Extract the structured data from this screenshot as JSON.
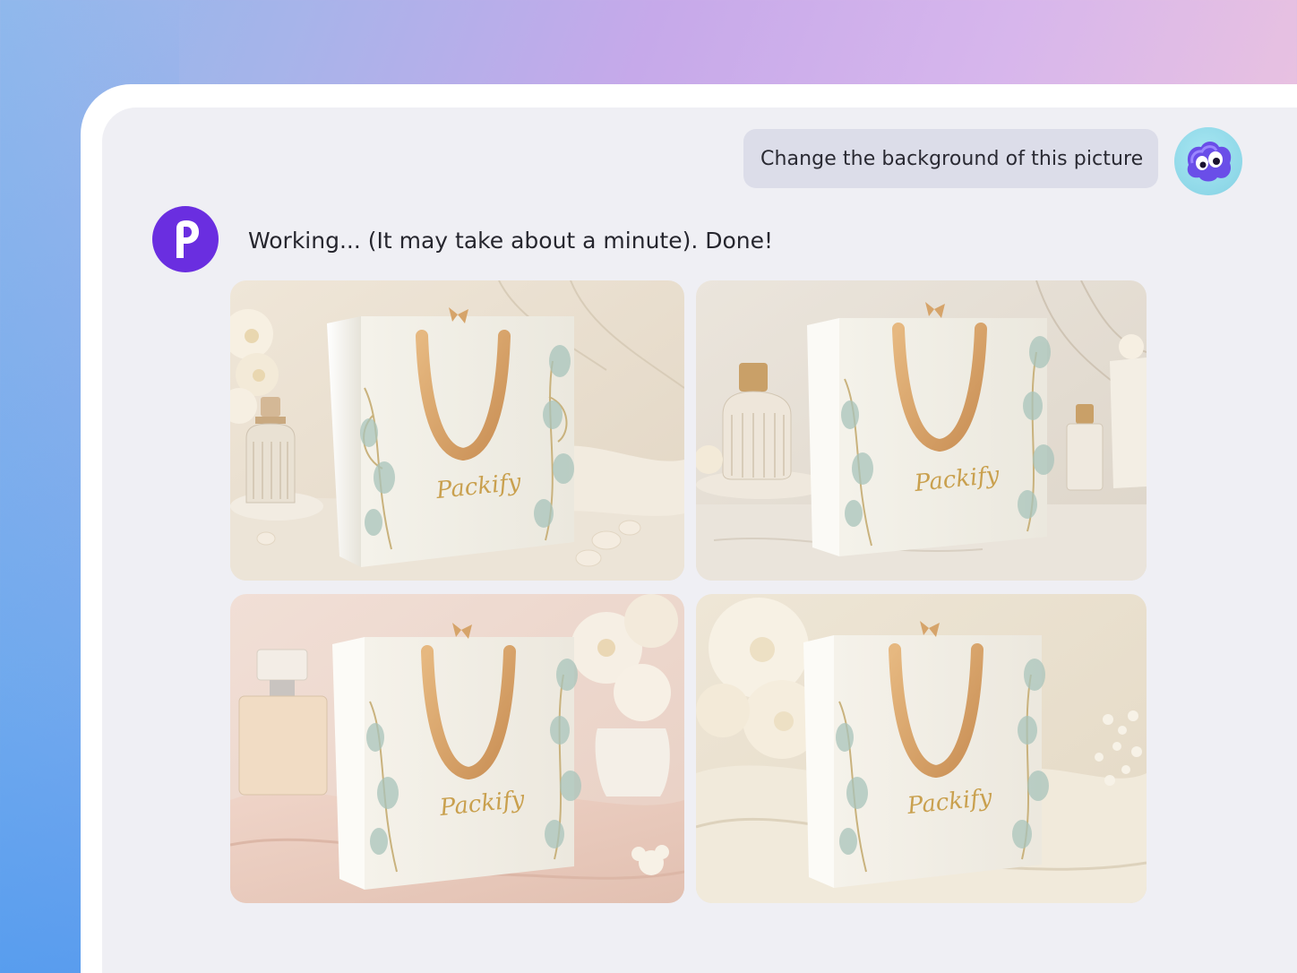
{
  "chat": {
    "user_message": "Change the background of this picture",
    "bot_message": "Working... (It may take about a minute). Done!"
  },
  "results": {
    "images": [
      {
        "label": "Packify",
        "scene": "marble-flowers-perfume"
      },
      {
        "label": "Packify",
        "scene": "marble-bottles"
      },
      {
        "label": "Packify",
        "scene": "pink-satin-flowers"
      },
      {
        "label": "Packify",
        "scene": "cream-fabric-flowers"
      }
    ]
  },
  "colors": {
    "bot_avatar": "#6a2ee0",
    "user_bubble": "#dcdde9",
    "panel": "#efeff4",
    "handle": "#d9a86a",
    "brand_text": "#c9a04e"
  },
  "icons": {
    "bot_avatar": "letter-p-logo-icon",
    "user_avatar": "purple-blob-character-icon"
  }
}
